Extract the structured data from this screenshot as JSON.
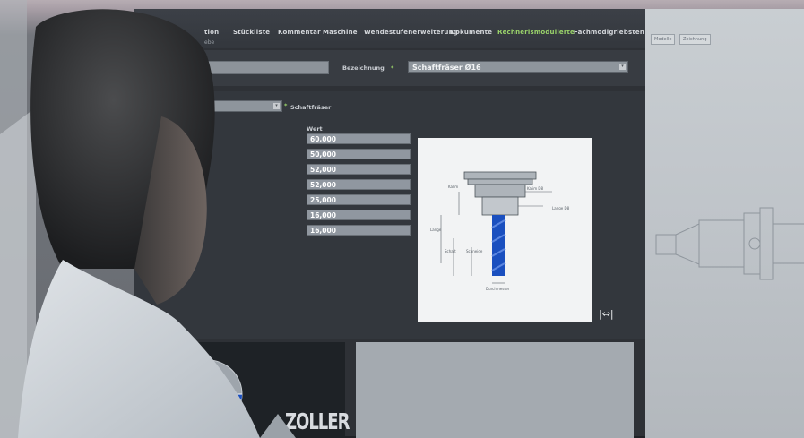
{
  "menu": {
    "tabs": [
      {
        "label": "tion"
      },
      {
        "label": "Stückliste"
      },
      {
        "label": "Kommentar"
      },
      {
        "label": "Maschine"
      },
      {
        "label": "Wendestufenerweiterung"
      },
      {
        "label": "Dokumente"
      },
      {
        "label": "Rechnerismodulierte"
      },
      {
        "label": "Fachmodigriebsten"
      }
    ],
    "active_tab": "Rechnerismodulierte",
    "subline": "ebe"
  },
  "right_panel": {
    "tabs": [
      {
        "label": "Modelle"
      },
      {
        "label": "Zeichnung"
      }
    ]
  },
  "header": {
    "designation_label": "Bezeichnung",
    "designation_value": "Schaftfräser Ø16"
  },
  "type": {
    "selected": "",
    "label": "Schaftfräser"
  },
  "params": {
    "column_header": "Wert",
    "values": [
      "60,000",
      "50,000",
      "52,000",
      "52,000",
      "25,000",
      "16,000",
      "16,000"
    ]
  },
  "diagram_labels": {
    "top_a": "Kalim",
    "top_b": "Kalim D8",
    "right": "Lange D8",
    "left_a": "Lange",
    "left_b": "Schaft",
    "mid": "Schneide",
    "bottom": "Durchmesser"
  },
  "bottom": {
    "brand": "ZOLLER"
  },
  "colors": {
    "accent_green": "#9ad36a",
    "tool_blue": "#1a4fbf"
  }
}
